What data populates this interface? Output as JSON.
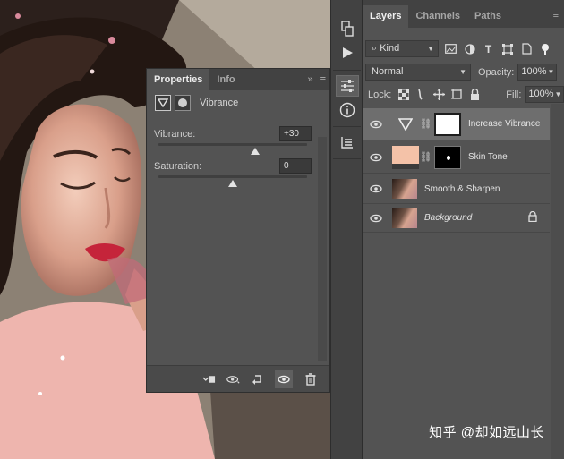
{
  "properties_panel": {
    "tabs": [
      {
        "label": "Properties"
      },
      {
        "label": "Info"
      }
    ],
    "adjustment_title": "Vibrance",
    "sliders": [
      {
        "label": "Vibrance:",
        "value": "+30",
        "level": 0.65
      },
      {
        "label": "Saturation:",
        "value": "0",
        "level": 0.5
      }
    ],
    "footer_icons": [
      "clip-to-layer-icon",
      "view-previous-icon",
      "reset-icon",
      "visibility-icon",
      "delete-icon"
    ],
    "menu_glyph": "≡",
    "collapse_glyph": "»"
  },
  "dock": {
    "buttons": [
      "history-icon",
      "play-icon",
      "adjustments-properties-icon",
      "info-icon",
      "layer-comps-icon"
    ]
  },
  "layers_panel": {
    "tabs": [
      {
        "label": "Layers"
      },
      {
        "label": "Channels"
      },
      {
        "label": "Paths"
      }
    ],
    "filter_kind": "Kind",
    "blend_mode": "Normal",
    "opacity_label": "Opacity:",
    "opacity_value": "100%",
    "lock_label": "Lock:",
    "fill_label": "Fill:",
    "fill_value": "100%",
    "layers": [
      {
        "name": "Increase Vibrance",
        "selected": true
      },
      {
        "name": "Skin Tone",
        "selected": false
      },
      {
        "name": "Smooth & Sharpen",
        "selected": false
      },
      {
        "name": "Background",
        "selected": false
      }
    ],
    "skin_tone_color": "#f4c2a8"
  },
  "watermark": "知乎 @却如远山长"
}
